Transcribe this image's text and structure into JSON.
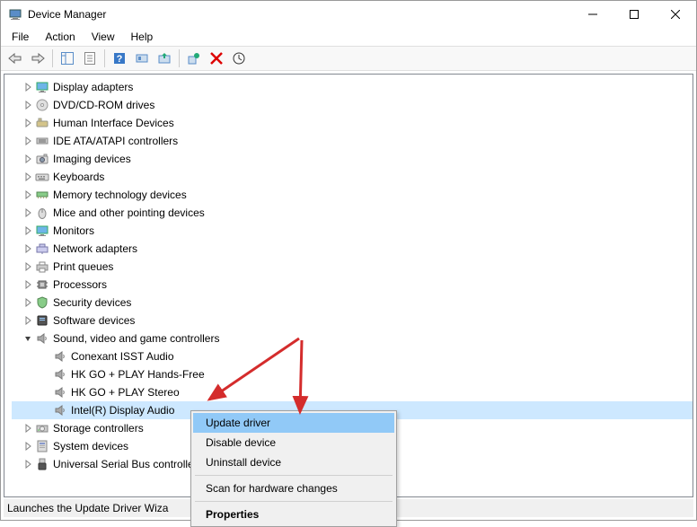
{
  "window": {
    "title": "Device Manager"
  },
  "menu": {
    "file": "File",
    "action": "Action",
    "view": "View",
    "help": "Help"
  },
  "tree": {
    "items": [
      {
        "label": "Display adapters",
        "icon": "monitor",
        "indent": 0,
        "expandable": true,
        "expanded": false
      },
      {
        "label": "DVD/CD-ROM drives",
        "icon": "disc",
        "indent": 0,
        "expandable": true,
        "expanded": false
      },
      {
        "label": "Human Interface Devices",
        "icon": "hid",
        "indent": 0,
        "expandable": true,
        "expanded": false
      },
      {
        "label": "IDE ATA/ATAPI controllers",
        "icon": "ide",
        "indent": 0,
        "expandable": true,
        "expanded": false
      },
      {
        "label": "Imaging devices",
        "icon": "camera",
        "indent": 0,
        "expandable": true,
        "expanded": false
      },
      {
        "label": "Keyboards",
        "icon": "keyboard",
        "indent": 0,
        "expandable": true,
        "expanded": false
      },
      {
        "label": "Memory technology devices",
        "icon": "memory",
        "indent": 0,
        "expandable": true,
        "expanded": false
      },
      {
        "label": "Mice and other pointing devices",
        "icon": "mouse",
        "indent": 0,
        "expandable": true,
        "expanded": false
      },
      {
        "label": "Monitors",
        "icon": "monitor",
        "indent": 0,
        "expandable": true,
        "expanded": false
      },
      {
        "label": "Network adapters",
        "icon": "network",
        "indent": 0,
        "expandable": true,
        "expanded": false
      },
      {
        "label": "Print queues",
        "icon": "printer",
        "indent": 0,
        "expandable": true,
        "expanded": false
      },
      {
        "label": "Processors",
        "icon": "cpu",
        "indent": 0,
        "expandable": true,
        "expanded": false
      },
      {
        "label": "Security devices",
        "icon": "security",
        "indent": 0,
        "expandable": true,
        "expanded": false
      },
      {
        "label": "Software devices",
        "icon": "software",
        "indent": 0,
        "expandable": true,
        "expanded": false
      },
      {
        "label": "Sound, video and game controllers",
        "icon": "speaker",
        "indent": 0,
        "expandable": true,
        "expanded": true
      },
      {
        "label": "Conexant ISST Audio",
        "icon": "speaker",
        "indent": 1,
        "expandable": false
      },
      {
        "label": "HK GO + PLAY Hands-Free",
        "icon": "speaker",
        "indent": 1,
        "expandable": false
      },
      {
        "label": "HK GO + PLAY Stereo",
        "icon": "speaker",
        "indent": 1,
        "expandable": false
      },
      {
        "label": "Intel(R) Display Audio",
        "icon": "speaker",
        "indent": 1,
        "expandable": false,
        "selected": true
      },
      {
        "label": "Storage controllers",
        "icon": "storage",
        "indent": 0,
        "expandable": true,
        "expanded": false
      },
      {
        "label": "System devices",
        "icon": "system",
        "indent": 0,
        "expandable": true,
        "expanded": false
      },
      {
        "label": "Universal Serial Bus controllers",
        "icon": "usb",
        "indent": 0,
        "expandable": true,
        "expanded": false
      }
    ]
  },
  "context_menu": {
    "items": [
      {
        "label": "Update driver",
        "highlight": true
      },
      {
        "label": "Disable device"
      },
      {
        "label": "Uninstall device"
      },
      {
        "type": "sep"
      },
      {
        "label": "Scan for hardware changes"
      },
      {
        "type": "sep"
      },
      {
        "label": "Properties",
        "bold": true
      }
    ]
  },
  "statusbar": {
    "text": "Launches the Update Driver Wiza"
  },
  "colors": {
    "selection": "#cde8ff",
    "menu_highlight": "#91c9f7",
    "arrow": "#d42c2c"
  }
}
